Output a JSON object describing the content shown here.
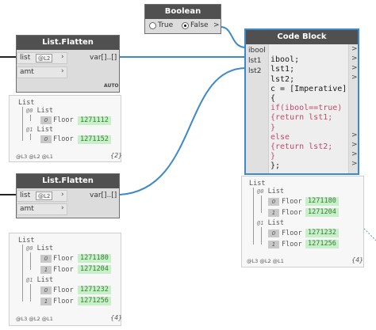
{
  "boolean_node": {
    "title": "Boolean",
    "true_label": "True",
    "false_label": "False",
    "output_arrow": ">"
  },
  "flatten_top": {
    "title": "List.Flatten",
    "inputs": [
      "list",
      "amt"
    ],
    "lacing_badge": "@L2",
    "output": "var[]..[]",
    "lacing_mode": "AUTO",
    "preview": {
      "root": "List",
      "groups": [
        {
          "index": "@0",
          "label": "List",
          "items": [
            {
              "index": "0",
              "key": "Floor",
              "value": "1271112"
            }
          ]
        },
        {
          "index": "@1",
          "label": "List",
          "items": [
            {
              "index": "0",
              "key": "Floor",
              "value": "1271152"
            }
          ]
        }
      ],
      "levels": "@L3 @L2 @L1",
      "count": "{2}"
    }
  },
  "flatten_bottom": {
    "title": "List.Flatten",
    "inputs": [
      "list",
      "amt"
    ],
    "lacing_badge": "@L2",
    "output": "var[]..[]",
    "preview": {
      "root": "List",
      "groups": [
        {
          "index": "@0",
          "label": "List",
          "items": [
            {
              "index": "0",
              "key": "Floor",
              "value": "1271180"
            },
            {
              "index": "1",
              "key": "Floor",
              "value": "1271204"
            }
          ]
        },
        {
          "index": "@1",
          "label": "List",
          "items": [
            {
              "index": "0",
              "key": "Floor",
              "value": "1271232"
            },
            {
              "index": "1",
              "key": "Floor",
              "value": "1271256"
            }
          ]
        }
      ],
      "levels": "@L3 @L2 @L1",
      "count": "{4}"
    }
  },
  "code_block": {
    "title": "Code Block",
    "inputs": [
      "ibool",
      "lst1",
      "lst2"
    ],
    "lines": [
      "ibool;",
      "lst1;",
      "lst2;",
      "c = [Imperative]",
      "{",
      "if(ibool==true)",
      "{return lst1;",
      "}",
      "else",
      "{return lst2;",
      "}",
      "};"
    ],
    "output_arrow": ">",
    "preview": {
      "root": "List",
      "groups": [
        {
          "index": "@0",
          "label": "List",
          "items": [
            {
              "index": "0",
              "key": "Floor",
              "value": "1271180"
            },
            {
              "index": "1",
              "key": "Floor",
              "value": "1271204"
            }
          ]
        },
        {
          "index": "@1",
          "label": "List",
          "items": [
            {
              "index": "0",
              "key": "Floor",
              "value": "1271232"
            },
            {
              "index": "1",
              "key": "Floor",
              "value": "1271256"
            }
          ]
        }
      ],
      "levels": "@L3 @L2 @L1",
      "count": "{4}"
    }
  },
  "colors": {
    "wire": "#3d8ac9",
    "node_header": "#505050",
    "value_bg": "#c8f0c8"
  }
}
